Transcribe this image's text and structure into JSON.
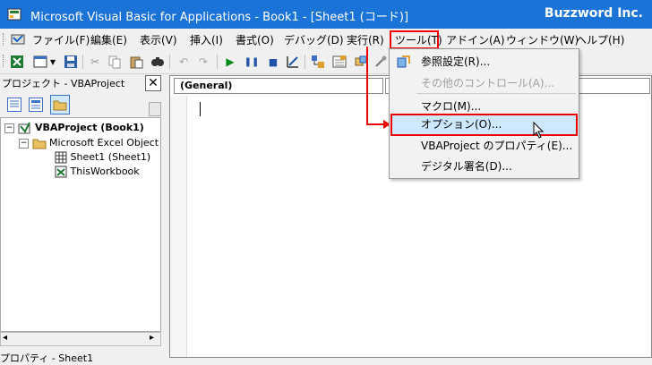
{
  "window": {
    "title": "Microsoft Visual Basic for Applications - Book1 - [Sheet1 (コード)]",
    "brand": "Buzzword Inc."
  },
  "menubar": {
    "items": [
      {
        "label": "ファイル(F)"
      },
      {
        "label": "編集(E)"
      },
      {
        "label": "表示(V)"
      },
      {
        "label": "挿入(I)"
      },
      {
        "label": "書式(O)"
      },
      {
        "label": "デバッグ(D)"
      },
      {
        "label": "実行(R)"
      },
      {
        "label": "ツール(T)"
      },
      {
        "label": "アドイン(A)"
      },
      {
        "label": "ウィンドウ(W)"
      },
      {
        "label": "ヘルプ(H)"
      }
    ]
  },
  "project": {
    "title": "プロジェクト - VBAProject",
    "close": "✕",
    "tree": {
      "root": "VBAProject (Book1)",
      "folder": "Microsoft Excel Object",
      "sheet": "Sheet1 (Sheet1)",
      "workbook": "ThisWorkbook"
    },
    "properties_title": "プロパティ - Sheet1"
  },
  "code": {
    "object_combo": "(General)"
  },
  "tools_menu": {
    "items": [
      {
        "label": "参照設定(R)...",
        "enabled": true
      },
      {
        "label": "その他のコントロール(A)...",
        "enabled": false
      },
      {
        "label": "マクロ(M)...",
        "enabled": true
      },
      {
        "label": "オプション(O)...",
        "enabled": true
      },
      {
        "label": "VBAProject のプロパティ(E)...",
        "enabled": true
      },
      {
        "label": "デジタル署名(D)...",
        "enabled": true
      }
    ]
  },
  "colors": {
    "titlebar": "#1a73d6",
    "highlight_border": "#e00000",
    "highlight_fill": "#cde8ff"
  }
}
